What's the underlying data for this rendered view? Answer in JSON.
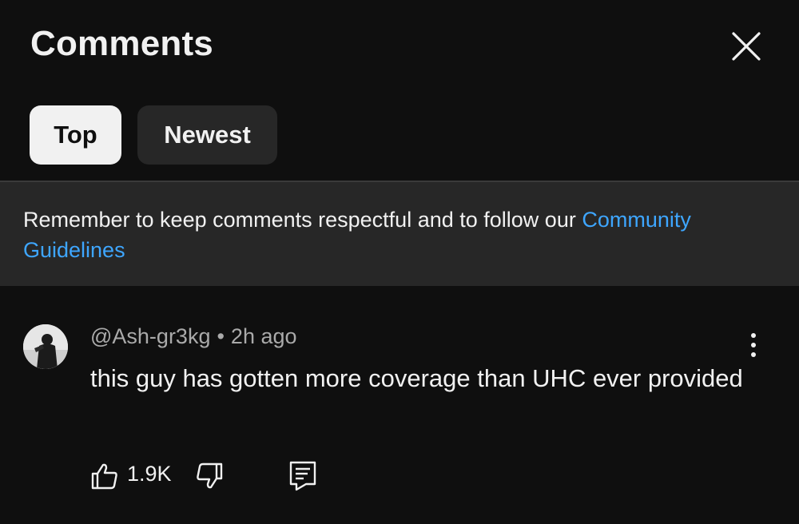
{
  "header": {
    "title": "Comments"
  },
  "filters": {
    "top_label": "Top",
    "newest_label": "Newest",
    "selected": "Top"
  },
  "notice": {
    "text": "Remember to keep comments respectful and to follow our ",
    "link_text": "Community Guidelines",
    "link_color": "#3ea6ff"
  },
  "comment": {
    "author": "@Ash-gr3kg",
    "separator": "•",
    "time": "2h ago",
    "body": "this guy has gotten more coverage than UHC ever provided",
    "like_count": "1.9K"
  },
  "icons": {
    "close": "close-icon",
    "menu": "more-vert-icon",
    "like": "thumbs-up-icon",
    "dislike": "thumbs-down-icon",
    "reply": "reply-comment-icon"
  },
  "colors": {
    "background": "#0f0f0f",
    "surface": "#272727",
    "text": "#f1f1f1",
    "secondary_text": "#aaaaaa",
    "accent": "#3ea6ff"
  }
}
